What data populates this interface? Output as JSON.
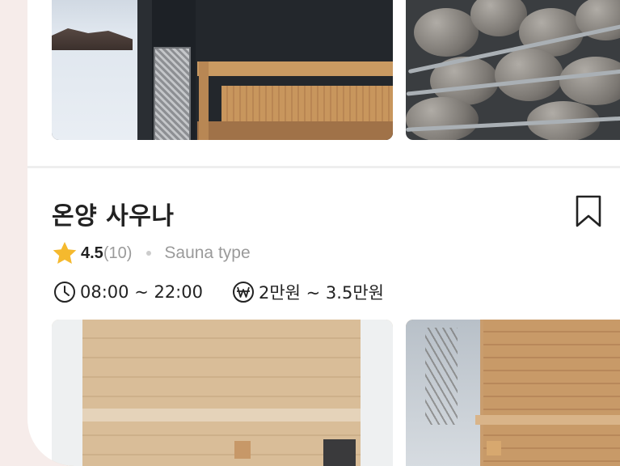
{
  "listing": {
    "name": "온양 사우나",
    "rating": "4.5",
    "review_count": "(10)",
    "type": "Sauna type",
    "hours": "08:00 ~ 22:00",
    "price": "2만원 ~ 3.5만원"
  },
  "icons": {
    "bookmark": "bookmark-icon",
    "rating": "star-icon",
    "hours": "clock-icon",
    "price": "won-icon"
  },
  "colors": {
    "star": "#f5b92e",
    "text_primary": "#222222",
    "text_secondary": "#9a9a9a",
    "background": "#f6ecea"
  }
}
